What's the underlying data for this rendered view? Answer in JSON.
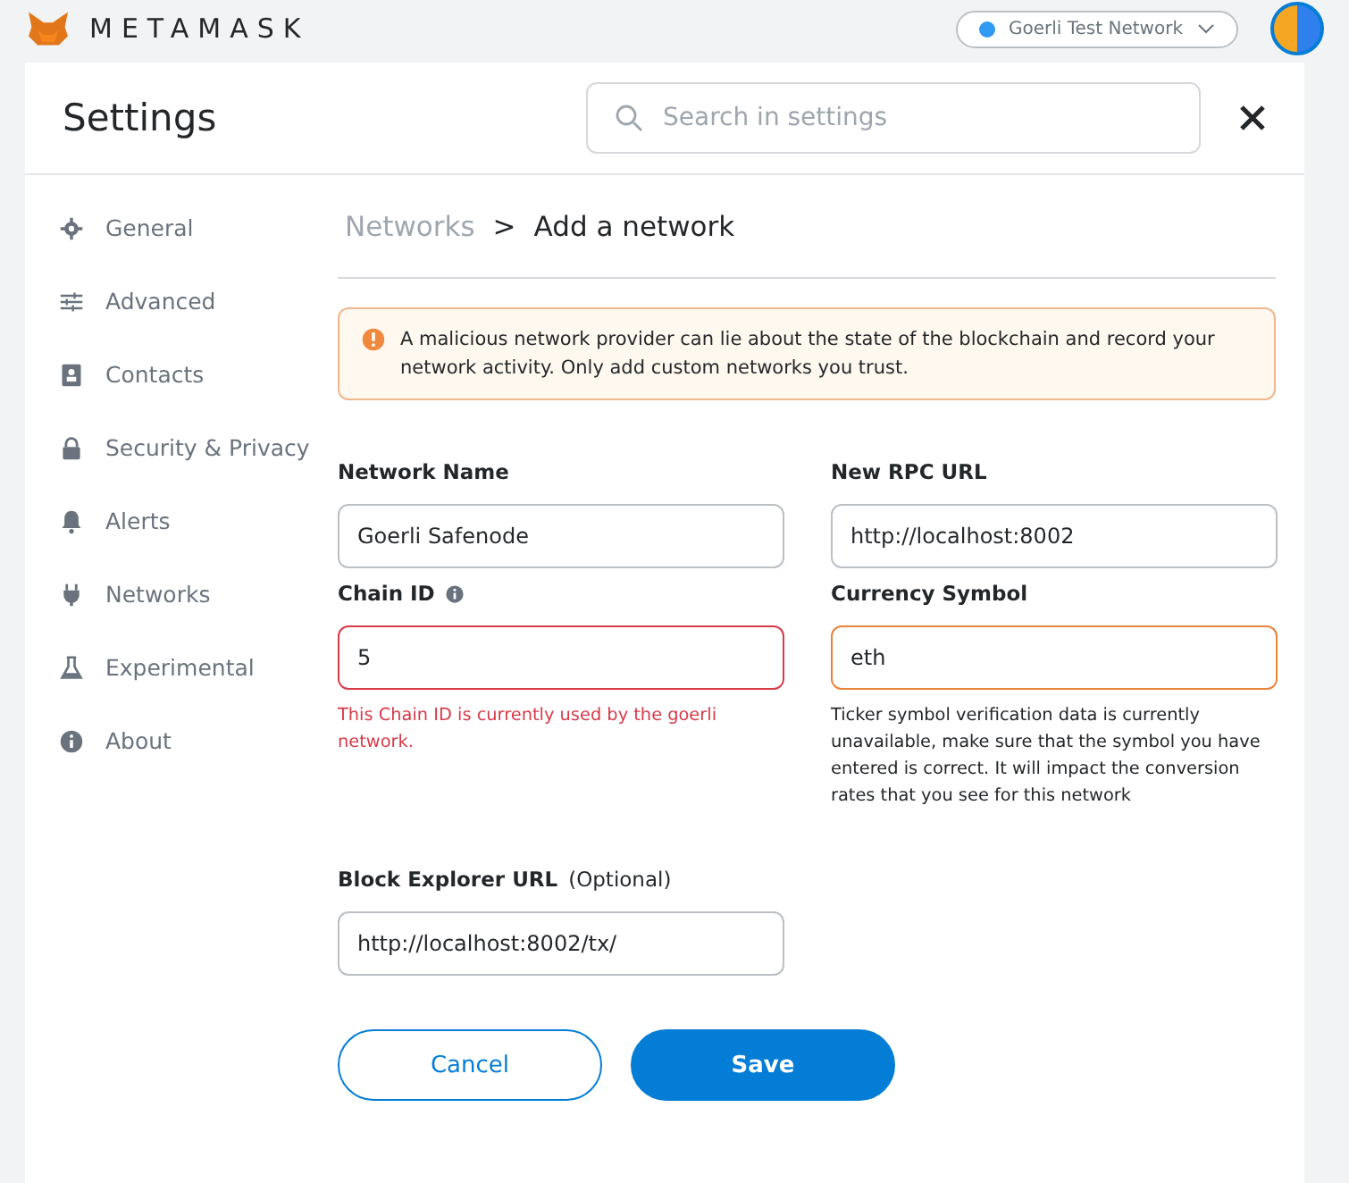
{
  "top_bar": {
    "brand": "METAMASK",
    "network": "Goerli Test Network"
  },
  "header": {
    "title": "Settings",
    "search": {
      "placeholder": "Search in settings"
    }
  },
  "sidebar": {
    "items": [
      {
        "label": "General"
      },
      {
        "label": "Advanced"
      },
      {
        "label": "Contacts"
      },
      {
        "label": "Security & Privacy"
      },
      {
        "label": "Alerts"
      },
      {
        "label": "Networks"
      },
      {
        "label": "Experimental"
      },
      {
        "label": "About"
      }
    ]
  },
  "breadcrumb": {
    "parent": "Networks",
    "separator": ">",
    "current": "Add a network"
  },
  "warning": "A malicious network provider can lie about the state of the blockchain and record your network activity. Only add custom networks you trust.",
  "fields": [
    {
      "label": "Network Name",
      "value": "Goerli Safenode",
      "invalid": false,
      "warning": false
    },
    {
      "label": "New RPC URL",
      "value": "http://localhost:8002",
      "invalid": false,
      "warning": false
    },
    {
      "label": "Chain ID",
      "info": true,
      "value": "5",
      "invalid": true,
      "warning": false,
      "message": "This Chain ID is currently used by the goerli network."
    },
    {
      "label": "Currency Symbol",
      "value": "eth",
      "invalid": false,
      "warning": true,
      "message": "Ticker symbol verification data is currently unavailable, make sure that the symbol you have entered is correct. It will impact the conversion rates that you see for this network"
    },
    {
      "label": "Block Explorer URL",
      "optional": "(Optional)",
      "value": "http://localhost:8002/tx/",
      "invalid": false,
      "warning": false
    }
  ],
  "buttons": {
    "cancel": "Cancel",
    "save": "Save"
  }
}
